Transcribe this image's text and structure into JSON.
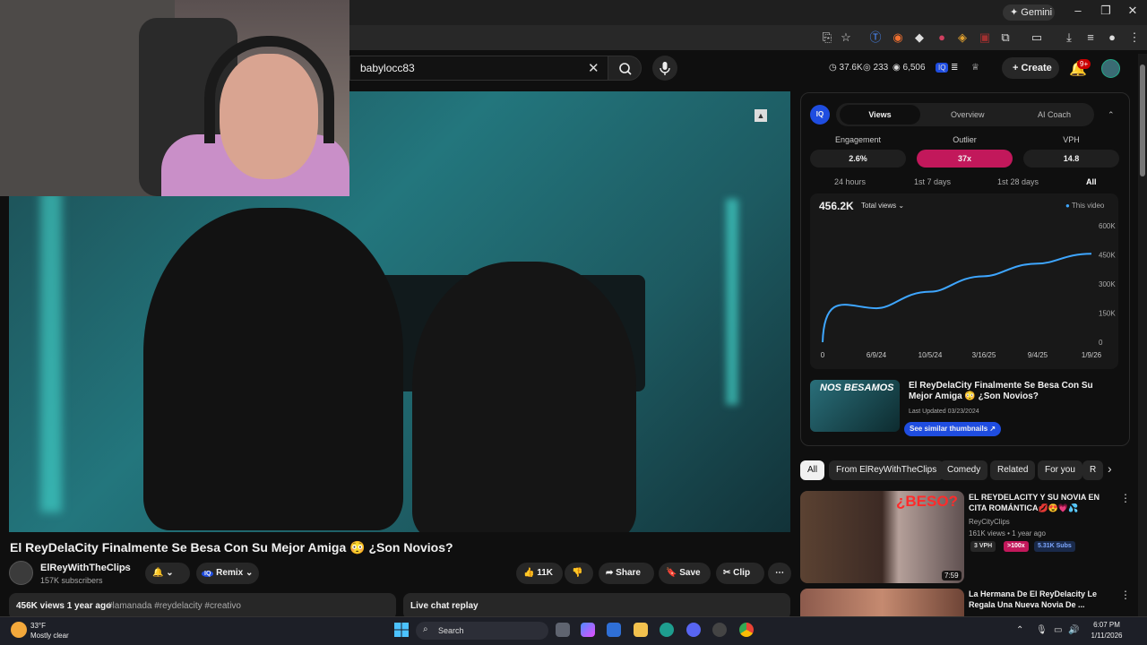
{
  "browser": {
    "gemini_label": "Gemini"
  },
  "header": {
    "search_value": "babylocc83",
    "stats": {
      "views": "37.6K",
      "watchers": "233",
      "count": "6,506"
    },
    "create_label": "Create",
    "notif_badge": "9+"
  },
  "video": {
    "title": "El ReyDelaCity Finalmente Se Besa Con Su Mejor Amiga 😳 ¿Son Novios?",
    "channel_name": "ElReyWithTheClips",
    "subscribers": "157K subscribers",
    "remix_label": "Remix",
    "likes": "11K",
    "share_label": "Share",
    "save_label": "Save",
    "clip_label": "Clip",
    "desc_views": "456K views  1 year ago",
    "desc_tags": "#lamanada #reydelacity #creativo",
    "live_chat_label": "Live chat replay"
  },
  "vidiq": {
    "logo": "IQ",
    "tabs": [
      "Views",
      "Overview",
      "AI Coach"
    ],
    "metrics": [
      {
        "label": "Engagement",
        "value": "2.6%"
      },
      {
        "label": "Outlier",
        "value": "37x"
      },
      {
        "label": "VPH",
        "value": "14.8"
      }
    ],
    "ranges": [
      "24 hours",
      "1st 7 days",
      "1st 28 days",
      "All"
    ],
    "total_value": "456.2K",
    "total_select": "Total views",
    "legend": "This video",
    "card_thumb_text": "NOS BESAMOS",
    "card_title": "El ReyDelaCity Finalmente Se Besa Con Su Mejor Amiga 😳 ¿Son Novios?",
    "card_updated": "Last Updated 03/23/2024",
    "card_button": "See similar thumbnails ↗"
  },
  "chart_data": {
    "type": "line",
    "x": [
      "0",
      "6/9/24",
      "10/5/24",
      "3/16/25",
      "9/4/25",
      "1/9/26"
    ],
    "series": [
      {
        "values": [
          0,
          175000,
          260000,
          340000,
          405000,
          456000
        ]
      }
    ],
    "y_ticks": [
      "600K",
      "450K",
      "300K",
      "150K",
      "0"
    ],
    "ylim": [
      0,
      600000
    ],
    "color": "#3ea6ff"
  },
  "chips": [
    "All",
    "From ElReyWithTheClips",
    "Comedy",
    "Related",
    "For you",
    "R"
  ],
  "recommendations": [
    {
      "title": "EL REYDELACITY Y SU NOVIA EN CITA ROMÁNTICA💋😍💗💦",
      "channel": "ReyCityClips",
      "meta": "161K views • 1 year ago",
      "vph": "3 VPH",
      "outlier": ">100x",
      "subs": "5.31K Subs",
      "duration": "7:59",
      "thumb_text": "¿BESO?"
    },
    {
      "title": "La Hermana De El ReyDelacity Le Regala Una Nueva Novia De ..."
    }
  ],
  "taskbar": {
    "temp": "33°F",
    "weather": "Mostly clear",
    "search_label": "Search",
    "time": "6:07 PM",
    "date": "1/11/2026"
  },
  "colors": {
    "accent_pink": "#c2185b",
    "vidiq_blue": "#1f4de0",
    "line_blue": "#3ea6ff"
  }
}
